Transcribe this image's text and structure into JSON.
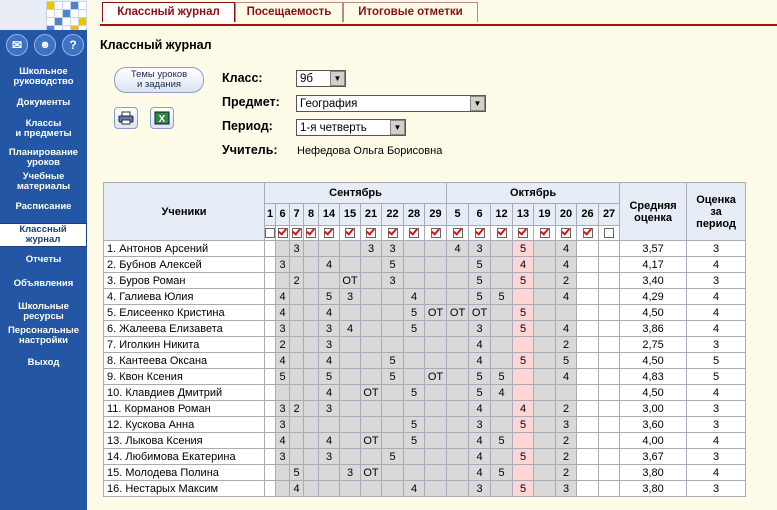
{
  "sidebar": {
    "items": [
      {
        "label": "Школьное руководство",
        "lines": [
          "Школьное",
          "руководство"
        ]
      },
      {
        "label": "Документы",
        "lines": [
          "Документы"
        ]
      },
      {
        "label": "Классы и предметы",
        "lines": [
          "Классы",
          "и предметы"
        ]
      },
      {
        "label": "Планирование уроков",
        "lines": [
          "Планирование",
          "уроков"
        ]
      },
      {
        "label": "Учебные материалы",
        "lines": [
          "Учебные",
          "материалы"
        ]
      },
      {
        "label": "Расписание",
        "lines": [
          "Расписание"
        ]
      },
      {
        "label": "Классный журнал",
        "lines": [
          "Классный",
          "журнал"
        ],
        "active": true
      },
      {
        "label": "Отчеты",
        "lines": [
          "Отчеты"
        ]
      },
      {
        "label": "Объявления",
        "lines": [
          "Объявления"
        ]
      },
      {
        "label": "Школьные ресурсы",
        "lines": [
          "Школьные",
          "ресурсы"
        ]
      },
      {
        "label": "Персональные настройки",
        "lines": [
          "Персональные",
          "настройки"
        ]
      },
      {
        "label": "Выход",
        "lines": [
          "Выход"
        ]
      }
    ]
  },
  "tabs": [
    {
      "label": "Классный журнал",
      "active": true
    },
    {
      "label": "Посещаемость",
      "active": false
    },
    {
      "label": "Итоговые отметки",
      "active": false
    }
  ],
  "page_title": "Классный журнал",
  "topics_button": "Темы уроков и задания",
  "topics_button_lines": [
    "Темы уроков",
    "и задания"
  ],
  "form": {
    "class_label": "Класс:",
    "class_value": "9б",
    "subject_label": "Предмет:",
    "subject_value": "География",
    "period_label": "Период:",
    "period_value": "1-я четверть",
    "teacher_label": "Учитель:",
    "teacher_value": "Нефедова Ольга Борисовна"
  },
  "grid": {
    "students_header": "Ученики",
    "months": [
      {
        "name": "Сентябрь",
        "days": [
          "1",
          "6",
          "7",
          "8",
          "14",
          "15",
          "21",
          "22",
          "28",
          "29"
        ]
      },
      {
        "name": "Октябрь",
        "days": [
          "5",
          "6",
          "12",
          "13",
          "19",
          "20",
          "26",
          "27"
        ]
      }
    ],
    "avg_header": "Средняя оценка",
    "avg_header_lines": [
      "Средняя",
      "оценка"
    ],
    "period_header": "Оценка за период",
    "period_header_lines": [
      "Оценка",
      "за",
      "период"
    ],
    "checkboxes": [
      false,
      true,
      true,
      true,
      true,
      true,
      true,
      true,
      true,
      true,
      true,
      true,
      true,
      true,
      true,
      true,
      true,
      false
    ],
    "rows": [
      {
        "name": "1. Антонов Арсений",
        "marks": [
          "",
          "",
          "3",
          "",
          "",
          "",
          "3",
          "3",
          "",
          "",
          "4",
          "3",
          "",
          "5",
          "",
          "4",
          "",
          ""
        ],
        "avg": "3,57",
        "final": "3"
      },
      {
        "name": "2. Бубнов Алексей",
        "marks": [
          "",
          "3",
          "",
          "",
          "4",
          "",
          "",
          "5",
          "",
          "",
          "",
          "5",
          "",
          "4",
          "",
          "4",
          "",
          ""
        ],
        "avg": "4,17",
        "final": "4"
      },
      {
        "name": "3. Буров Роман",
        "marks": [
          "",
          "",
          "2",
          "",
          "",
          "ОТ",
          "",
          "3",
          "",
          "",
          "",
          "5",
          "",
          "5",
          "",
          "2",
          "",
          ""
        ],
        "avg": "3,40",
        "final": "3"
      },
      {
        "name": "4. Галиева Юлия",
        "marks": [
          "",
          "4",
          "",
          "",
          "5",
          "3",
          "",
          "",
          "4",
          "",
          "",
          "5",
          "5",
          "",
          "",
          "4",
          "",
          ""
        ],
        "avg": "4,29",
        "final": "4"
      },
      {
        "name": "5. Елисеенко Кристина",
        "marks": [
          "",
          "4",
          "",
          "",
          "4",
          "",
          "",
          "",
          "5",
          "ОТ",
          "ОТ",
          "ОТ",
          "",
          "5",
          "",
          "",
          "",
          ""
        ],
        "avg": "4,50",
        "final": "4"
      },
      {
        "name": "6. Жалеева Елизавета",
        "marks": [
          "",
          "3",
          "",
          "",
          "3",
          "4",
          "",
          "",
          "5",
          "",
          "",
          "3",
          "",
          "5",
          "",
          "4",
          "",
          ""
        ],
        "avg": "3,86",
        "final": "4"
      },
      {
        "name": "7. Иголкин Никита",
        "marks": [
          "",
          "2",
          "",
          "",
          "3",
          "",
          "",
          "",
          "",
          "",
          "",
          "4",
          "",
          "",
          "",
          "2",
          "",
          ""
        ],
        "avg": "2,75",
        "final": "3"
      },
      {
        "name": "8. Кантеева Оксана",
        "marks": [
          "",
          "4",
          "",
          "",
          "4",
          "",
          "",
          "5",
          "",
          "",
          "",
          "4",
          "",
          "5",
          "",
          "5",
          "",
          ""
        ],
        "avg": "4,50",
        "final": "5"
      },
      {
        "name": "9. Квон Ксения",
        "marks": [
          "",
          "5",
          "",
          "",
          "5",
          "",
          "",
          "5",
          "",
          "ОТ",
          "",
          "5",
          "5",
          "",
          "",
          "4",
          "",
          ""
        ],
        "avg": "4,83",
        "final": "5"
      },
      {
        "name": "10. Клавдиев Дмитрий",
        "marks": [
          "",
          "",
          "",
          "",
          "4",
          "",
          "ОТ",
          "",
          "5",
          "",
          "",
          "5",
          "4",
          "",
          "",
          "",
          "",
          ""
        ],
        "avg": "4,50",
        "final": "4"
      },
      {
        "name": "11. Корманов Роман",
        "marks": [
          "",
          "3",
          "2",
          "",
          "3",
          "",
          "",
          "",
          "",
          "",
          "",
          "4",
          "",
          "4",
          "",
          "2",
          "",
          ""
        ],
        "avg": "3,00",
        "final": "3"
      },
      {
        "name": "12. Кускова Анна",
        "marks": [
          "",
          "3",
          "",
          "",
          "",
          "",
          "",
          "",
          "5",
          "",
          "",
          "3",
          "",
          "5",
          "",
          "3",
          "",
          ""
        ],
        "avg": "3,60",
        "final": "3"
      },
      {
        "name": "13. Лыкова Ксения",
        "marks": [
          "",
          "4",
          "",
          "",
          "4",
          "",
          "ОТ",
          "",
          "5",
          "",
          "",
          "4",
          "5",
          "",
          "",
          "2",
          "",
          ""
        ],
        "avg": "4,00",
        "final": "4"
      },
      {
        "name": "14. Любимова Екатерина",
        "marks": [
          "",
          "3",
          "",
          "",
          "3",
          "",
          "",
          "5",
          "",
          "",
          "",
          "4",
          "",
          "5",
          "",
          "2",
          "",
          ""
        ],
        "avg": "3,67",
        "final": "3"
      },
      {
        "name": "15. Молодева Полина",
        "marks": [
          "",
          "",
          "5",
          "",
          "",
          "3",
          "ОТ",
          "",
          "",
          "",
          "",
          "4",
          "5",
          "",
          "",
          "2",
          "",
          ""
        ],
        "avg": "3,80",
        "final": "4"
      },
      {
        "name": "16. Нестарых Максим",
        "marks": [
          "",
          "",
          "4",
          "",
          "",
          "",
          "",
          "",
          "4",
          "",
          "",
          "3",
          "",
          "5",
          "",
          "3",
          "",
          ""
        ],
        "avg": "3,80",
        "final": "3"
      }
    ]
  },
  "colors": {
    "sidebar": "#2356a5",
    "tab_text": "#8b1010",
    "highlight_col": "#ffd6d6",
    "gray_cell": "#d9d9d9"
  },
  "icons": [
    "mail-icon",
    "users-icon",
    "help-icon",
    "print-icon",
    "excel-icon"
  ]
}
